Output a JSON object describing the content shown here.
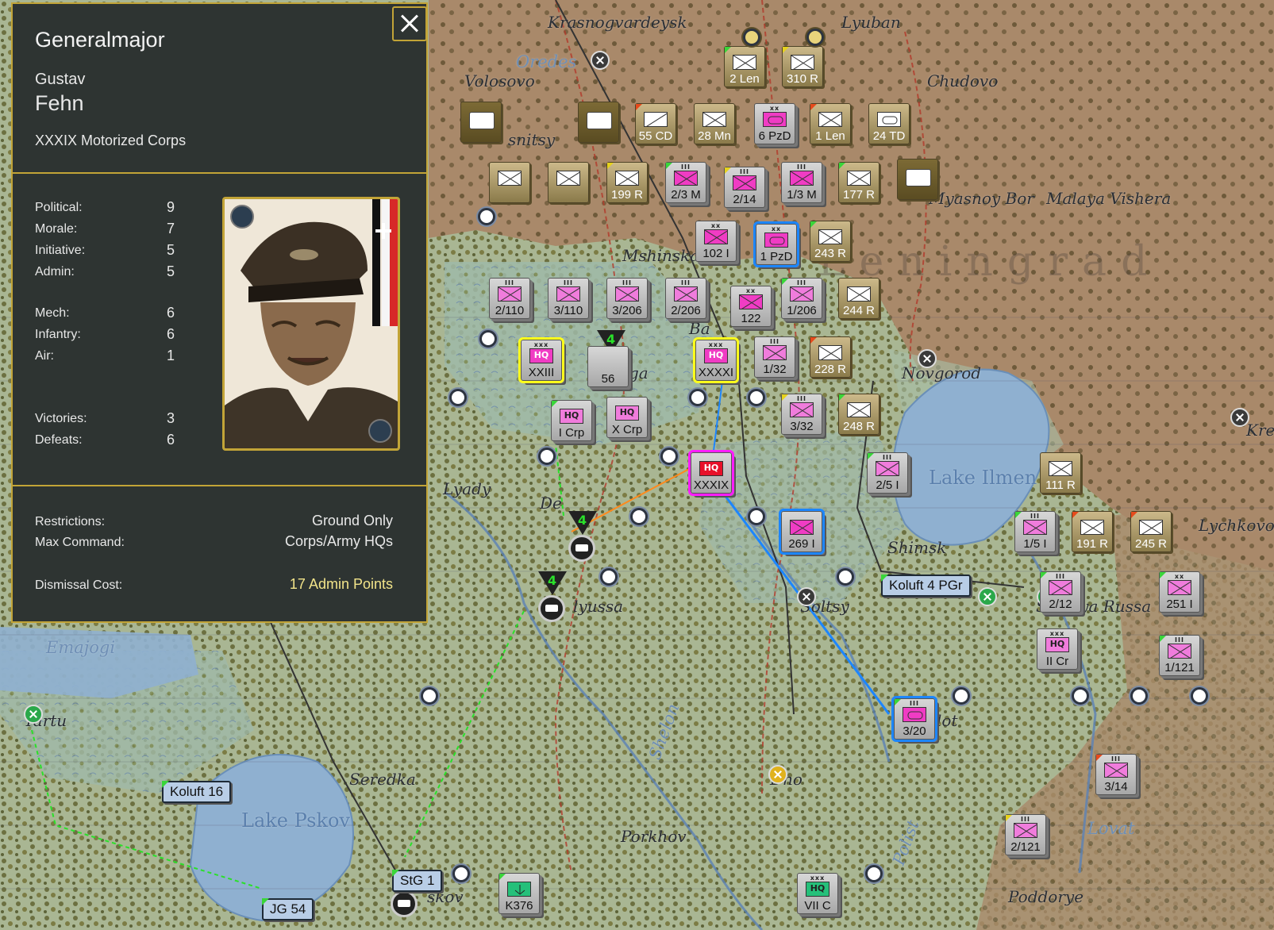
{
  "leader": {
    "rank": "Generalmajor",
    "first_name": "Gustav",
    "last_name": "Fehn",
    "command": "XXXIX Motorized Corps",
    "stats": [
      {
        "label": "Political:",
        "value": "9"
      },
      {
        "label": "Morale:",
        "value": "7"
      },
      {
        "label": "Initiative:",
        "value": "5"
      },
      {
        "label": "Admin:",
        "value": "5"
      },
      {
        "label": "Mech:",
        "value": "6"
      },
      {
        "label": "Infantry:",
        "value": "6"
      },
      {
        "label": "Air:",
        "value": "1"
      },
      {
        "label": "Victories:",
        "value": "3"
      },
      {
        "label": "Defeats:",
        "value": "6"
      }
    ],
    "restrictions_label": "Restrictions:",
    "restrictions_value": "Ground Only",
    "max_command_label": "Max Command:",
    "max_command_value": "Corps/Army HQs",
    "dismissal_label": "Dismissal Cost:",
    "dismissal_value": "17 Admin Points"
  },
  "places": {
    "krasnogvardeysk": "Krasnogvardeysk",
    "lyuban": "Lyuban",
    "oredes": "Oredes",
    "volosovo": "Volosovo",
    "chudovo": "Chudovo",
    "lisnitsy": "snitsy",
    "myasnoy_bor": "Myasnoy Bor",
    "malaya_vishera": "Malaya Vishera",
    "mshinskaya": "Mshinskaya",
    "leningrad": "Leningrad",
    "batetsky": "Ba",
    "novgorod": "Novgorod",
    "lake_ilmen": "Lake Ilmen",
    "kre": "Kre",
    "lyady": "Lyady",
    "shimsk": "Shimsk",
    "lychkovo": "Lychkovo",
    "plyussa": "lyussa",
    "soltsy": "Soltsy",
    "staraya_russa": "Staraya Russa",
    "emajogi": "Emajogi",
    "tartu": "Tartu",
    "shelon": "Shelon",
    "seredka": "Seredka",
    "dno": "Dno",
    "lake_pskov": "Lake Pskov",
    "porkhov": "Porkhov",
    "lovat": "Lovat",
    "poddorye": "Poddorye",
    "pskov": "skov",
    "polist": "Polist",
    "dedovichi": "De",
    "ga": "ga",
    "lot": "lot"
  },
  "units": [
    {
      "id": "2len",
      "label": "2 Len",
      "style": "fin"
    },
    {
      "id": "310r",
      "label": "310 R",
      "style": "fin"
    },
    {
      "id": "55cd",
      "label": "55 CD",
      "style": "fin"
    },
    {
      "id": "28mn",
      "label": "28 Mn",
      "style": "fin"
    },
    {
      "id": "6pzd",
      "label": "6 PzD",
      "style": "gray",
      "size": "xx"
    },
    {
      "id": "1len",
      "label": "1 Len",
      "style": "fin"
    },
    {
      "id": "24td",
      "label": "24 TD",
      "style": "fin"
    },
    {
      "id": "199r",
      "label": "199 R",
      "style": "fin"
    },
    {
      "id": "23m",
      "label": "2/3 M",
      "style": "gray",
      "size": "III"
    },
    {
      "id": "214",
      "label": "2/14",
      "style": "gray",
      "size": "III"
    },
    {
      "id": "13m",
      "label": "1/3 M",
      "style": "gray",
      "size": "III"
    },
    {
      "id": "177r",
      "label": "177 R",
      "style": "fin"
    },
    {
      "id": "102i",
      "label": "102 I",
      "style": "gray",
      "size": "xx"
    },
    {
      "id": "1pzd",
      "label": "1 PzD",
      "style": "gray",
      "size": "xx"
    },
    {
      "id": "243r",
      "label": "243 R",
      "style": "fin"
    },
    {
      "id": "2110",
      "label": "2/110",
      "style": "gray",
      "size": "III"
    },
    {
      "id": "3110",
      "label": "3/110",
      "style": "gray",
      "size": "III"
    },
    {
      "id": "3206",
      "label": "3/206",
      "style": "gray",
      "size": "III"
    },
    {
      "id": "2206",
      "label": "2/206",
      "style": "gray",
      "size": "III"
    },
    {
      "id": "122",
      "label": "122",
      "style": "gray",
      "size": "xx"
    },
    {
      "id": "1206",
      "label": "1/206",
      "style": "gray",
      "size": "III"
    },
    {
      "id": "244r",
      "label": "244 R",
      "style": "fin"
    },
    {
      "id": "xxiii",
      "label": "XXIII",
      "style": "gray",
      "hq": "HQ",
      "size": "xxx"
    },
    {
      "id": "156",
      "label": "56",
      "style": "gray"
    },
    {
      "id": "xxxxi",
      "label": "XXXXI",
      "style": "gray",
      "hq": "HQ",
      "size": "xxx"
    },
    {
      "id": "132",
      "label": "1/32",
      "style": "gray",
      "size": "III"
    },
    {
      "id": "228r",
      "label": "228 R",
      "style": "fin"
    },
    {
      "id": "icrp",
      "label": "I Crp",
      "style": "gray",
      "hq": "HQ"
    },
    {
      "id": "xcrp",
      "label": "X Crp",
      "style": "gray",
      "hq": "HQ"
    },
    {
      "id": "332",
      "label": "3/32",
      "style": "gray",
      "size": "III"
    },
    {
      "id": "248r",
      "label": "248 R",
      "style": "fin"
    },
    {
      "id": "xxxix",
      "label": "XXXIX",
      "style": "gray",
      "hq": "HQ"
    },
    {
      "id": "25i",
      "label": "2/5 I",
      "style": "gray",
      "size": "III"
    },
    {
      "id": "111r",
      "label": "111 R",
      "style": "fin"
    },
    {
      "id": "269i",
      "label": "269 I",
      "style": "gray"
    },
    {
      "id": "15i",
      "label": "1/5 I",
      "style": "gray",
      "size": "III"
    },
    {
      "id": "191r",
      "label": "191 R",
      "style": "fin"
    },
    {
      "id": "245r",
      "label": "245 R",
      "style": "fin"
    },
    {
      "id": "212",
      "label": "2/12",
      "style": "gray",
      "size": "III"
    },
    {
      "id": "251i",
      "label": "251 I",
      "style": "gray",
      "size": "xx"
    },
    {
      "id": "iicr",
      "label": "II Cr",
      "style": "gray",
      "hq": "HQ",
      "size": "xxx"
    },
    {
      "id": "1121",
      "label": "1/121",
      "style": "gray",
      "size": "III"
    },
    {
      "id": "320",
      "label": "3/20",
      "style": "gray",
      "size": "III"
    },
    {
      "id": "314",
      "label": "3/14",
      "style": "gray",
      "size": "III"
    },
    {
      "id": "2121",
      "label": "2/121",
      "style": "gray",
      "size": "III"
    },
    {
      "id": "k376",
      "label": "K376",
      "style": "gray"
    },
    {
      "id": "viic",
      "label": "VII C",
      "style": "gray",
      "hq": "HQ",
      "size": "xxx"
    }
  ],
  "air_units": [
    {
      "id": "koluft4pgr",
      "label": "Koluft 4 PGr"
    },
    {
      "id": "koluft16",
      "label": "Koluft 16"
    },
    {
      "id": "stg1",
      "label": "StG 1"
    },
    {
      "id": "jg54",
      "label": "JG 54"
    }
  ],
  "rail_numbers": [
    "4",
    "4",
    "4"
  ]
}
